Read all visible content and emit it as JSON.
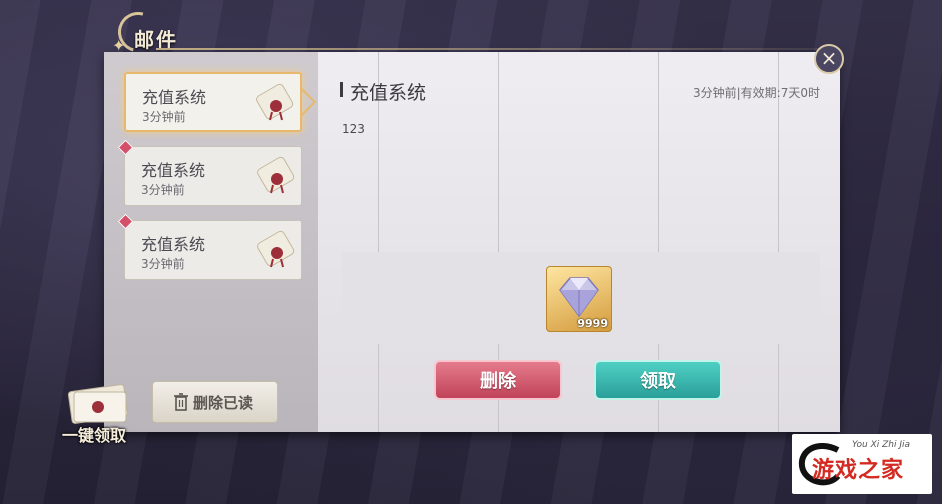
{
  "window": {
    "title": "邮件"
  },
  "mail_list": [
    {
      "title": "充值系统",
      "time": "3分钟前",
      "active": true,
      "unread": false
    },
    {
      "title": "充值系统",
      "time": "3分钟前",
      "active": false,
      "unread": true
    },
    {
      "title": "充值系统",
      "time": "3分钟前",
      "active": false,
      "unread": true
    }
  ],
  "detail": {
    "title": "充值系统",
    "meta": "3分钟前|有效期:7天0时",
    "body": "123",
    "reward": {
      "icon": "diamond-icon",
      "quantity": "9999"
    }
  },
  "buttons": {
    "delete": "删除",
    "claim": "领取",
    "delete_read": "删除已读",
    "one_click_claim": "一键领取"
  },
  "watermark": {
    "text": "游戏之家",
    "small": "You Xi Zhi Jia"
  },
  "colors": {
    "delete": "#c14359",
    "claim": "#2a9f9a",
    "accent": "#e8b86c"
  }
}
